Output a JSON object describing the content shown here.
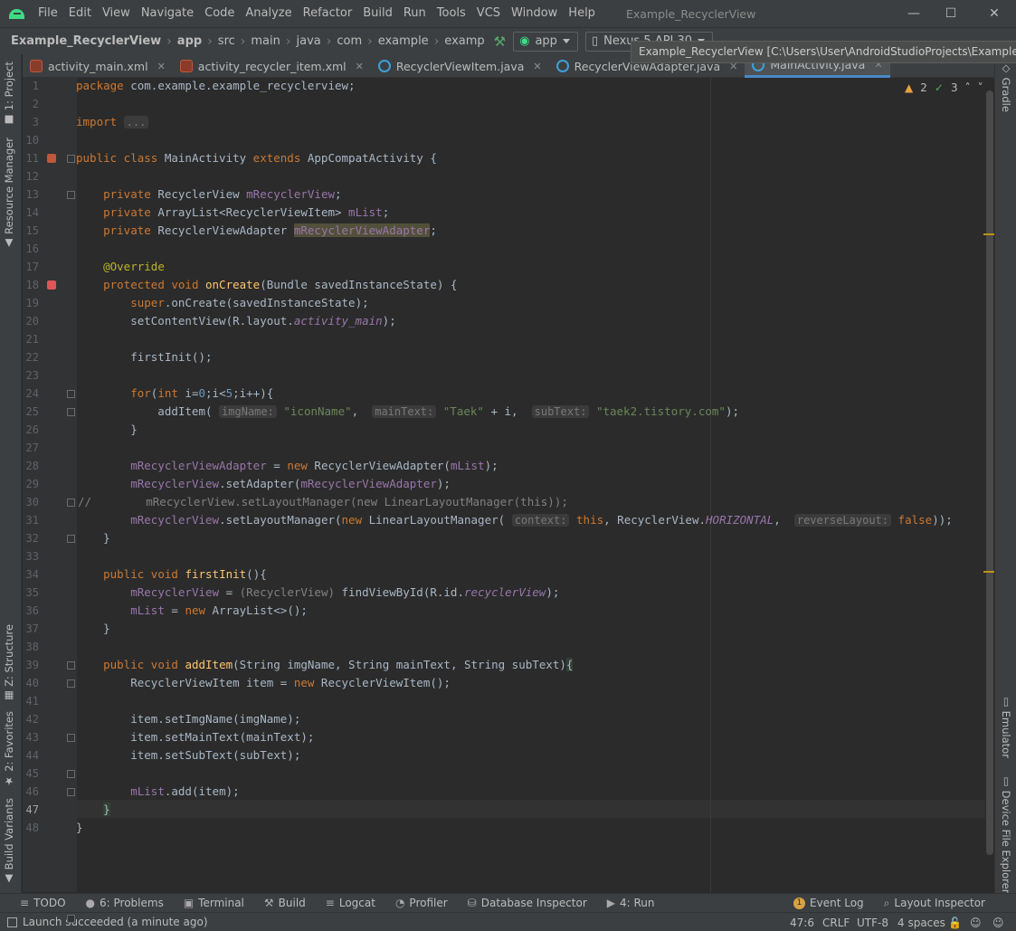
{
  "menubar": {
    "items": [
      "File",
      "Edit",
      "View",
      "Navigate",
      "Code",
      "Analyze",
      "Refactor",
      "Build",
      "Run",
      "Tools",
      "VCS",
      "Window",
      "Help"
    ],
    "window_title": "Example_RecyclerView"
  },
  "navbar": {
    "breadcrumbs": [
      "Example_RecyclerView",
      "app",
      "src",
      "main",
      "java",
      "com",
      "example",
      "examp"
    ],
    "run_config": "app",
    "device": "Nexus 5 API 30"
  },
  "tooltip": "Example_RecyclerView [C:\\Users\\User\\AndroidStudioProjects\\Example_Recy",
  "left_tools": [
    "1: Project",
    "Resource Manager",
    "Z: Structure",
    "2: Favorites",
    "Build Variants"
  ],
  "right_tools": [
    "Gradle",
    "Emulator",
    "Device File Explorer"
  ],
  "tabs": [
    {
      "label": "activity_main.xml",
      "type": "xml"
    },
    {
      "label": "activity_recycler_item.xml",
      "type": "xml"
    },
    {
      "label": "RecyclerViewItem.java",
      "type": "java"
    },
    {
      "label": "RecyclerViewAdapter.java",
      "type": "java"
    },
    {
      "label": "MainActivity.java",
      "type": "java"
    }
  ],
  "inspections": {
    "warnings": "2",
    "weak_warnings": "3"
  },
  "editor": {
    "line_numbers": [
      "1",
      "2",
      "3",
      "10",
      "11",
      "12",
      "13",
      "14",
      "15",
      "16",
      "17",
      "18",
      "19",
      "20",
      "21",
      "22",
      "23",
      "24",
      "25",
      "26",
      "27",
      "28",
      "29",
      "30",
      "31",
      "32",
      "33",
      "34",
      "35",
      "36",
      "37",
      "38",
      "39",
      "40",
      "41",
      "42",
      "43",
      "44",
      "45",
      "46",
      "47",
      "48"
    ],
    "current_line": "47"
  },
  "toolwindows": [
    {
      "label": "TODO",
      "icon": "≡"
    },
    {
      "label": "6: Problems",
      "icon": "●"
    },
    {
      "label": "Terminal",
      "icon": "▣"
    },
    {
      "label": "Build",
      "icon": "⚒"
    },
    {
      "label": "Logcat",
      "icon": "≡"
    },
    {
      "label": "Profiler",
      "icon": "◔"
    },
    {
      "label": "Database Inspector",
      "icon": "⛁"
    },
    {
      "label": "4: Run",
      "icon": "▶"
    }
  ],
  "toolwindows_right": [
    {
      "label": "Event Log",
      "badge": "1"
    },
    {
      "label": "Layout Inspector",
      "icon": "⌕"
    }
  ],
  "status": {
    "message": "Launch succeeded (a minute ago)",
    "position": "47:6",
    "line_sep": "CRLF",
    "encoding": "UTF-8",
    "indent": "4 spaces"
  }
}
